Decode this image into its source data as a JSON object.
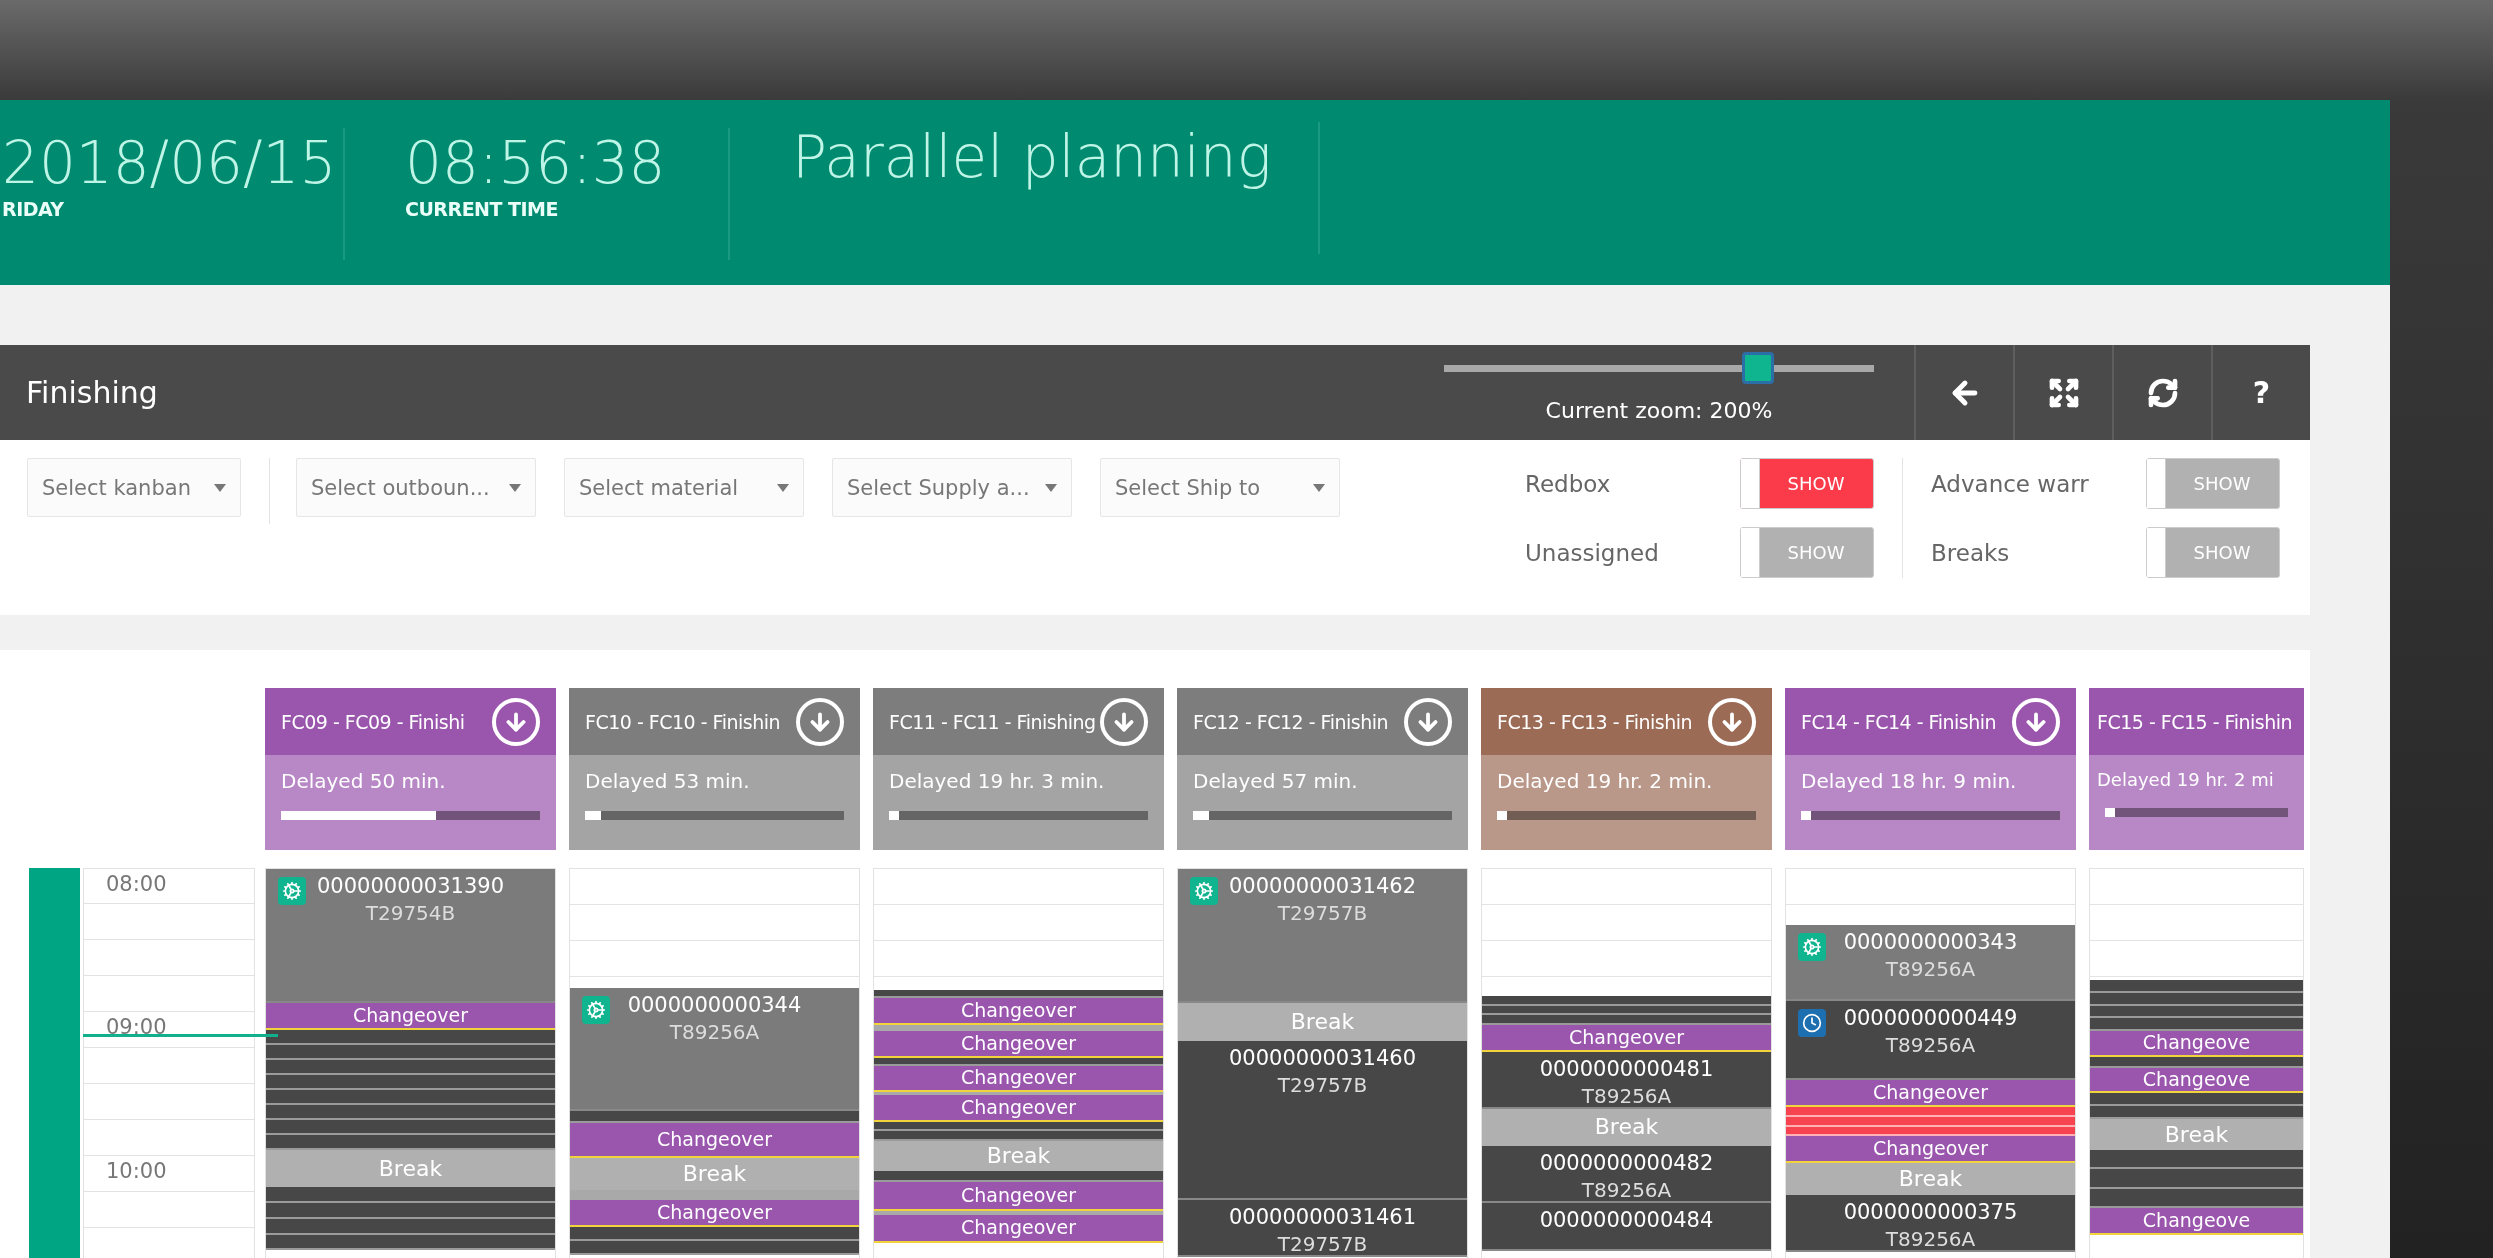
{
  "header": {
    "date": "2018/06/15",
    "weekday": "RIDAY",
    "time": "08:56:38",
    "time_label": "CURRENT TIME",
    "title": "Parallel planning"
  },
  "toolbar": {
    "title": "Finishing",
    "zoom": {
      "level": 0.73,
      "label": "Current zoom: 200%"
    },
    "help": "?"
  },
  "filters": [
    {
      "placeholder": "Select kanban"
    },
    {
      "placeholder": "Select outboun..."
    },
    {
      "placeholder": "Select material"
    },
    {
      "placeholder": "Select Supply a..."
    },
    {
      "placeholder": "Select Ship to"
    }
  ],
  "toggle_groups": [
    [
      {
        "label": "Redbox",
        "text": "SHOW",
        "on": true
      },
      {
        "label": "Unassigned",
        "text": "SHOW",
        "on": false
      }
    ],
    [
      {
        "label": "Advance warr",
        "text": "SHOW",
        "on": false
      },
      {
        "label": "Breaks",
        "text": "SHOW",
        "on": false
      }
    ]
  ],
  "timeline": {
    "hours": [
      "08:00",
      "09:00",
      "10:00"
    ]
  },
  "columns": [
    {
      "title": "FC09 - FC09 - Finishi",
      "color": "#9a55ad",
      "status": "Delayed 50 min.",
      "level": 0.6,
      "blocks": [
        {
          "kind": "running-order",
          "number": "00000000031390",
          "material": "T29754B"
        },
        {
          "kind": "changeover",
          "text": "Changeover"
        },
        {
          "kind": "sliver"
        },
        {
          "kind": "sliver"
        },
        {
          "kind": "sliver"
        },
        {
          "kind": "sliver"
        },
        {
          "kind": "sliver"
        },
        {
          "kind": "sliver"
        },
        {
          "kind": "sliver"
        },
        {
          "kind": "sliver"
        },
        {
          "kind": "break",
          "text": "Break"
        },
        {
          "kind": "sliver"
        },
        {
          "kind": "sliver"
        },
        {
          "kind": "sliver"
        },
        {
          "kind": "sliver"
        }
      ]
    },
    {
      "title": "FC10 - FC10 - Finishin",
      "color": "#7d7d7d",
      "status": "Delayed 53 min.",
      "level": 0.06,
      "blocks": [
        {
          "kind": "empty"
        },
        {
          "kind": "running-order",
          "number": "0000000000344",
          "material": "T89256A"
        },
        {
          "kind": "sliver"
        },
        {
          "kind": "changeover",
          "text": "Changeover"
        },
        {
          "kind": "break",
          "text": "Break"
        },
        {
          "kind": "gap"
        },
        {
          "kind": "changeover",
          "text": "Changeover"
        },
        {
          "kind": "sliver"
        },
        {
          "kind": "sliver"
        }
      ]
    },
    {
      "title": "FC11 - FC11 - Finishing",
      "color": "#7d7d7d",
      "status": "Delayed 19 hr. 3 min.",
      "level": 0.02,
      "blocks": [
        {
          "kind": "empty"
        },
        {
          "kind": "sliver"
        },
        {
          "kind": "changeover",
          "text": "Changeover"
        },
        {
          "kind": "gap"
        },
        {
          "kind": "changeover",
          "text": "Changeover"
        },
        {
          "kind": "sliver"
        },
        {
          "kind": "changeover",
          "text": "Changeover"
        },
        {
          "kind": "gap"
        },
        {
          "kind": "changeover",
          "text": "Changeover"
        },
        {
          "kind": "sliver"
        },
        {
          "kind": "sliver"
        },
        {
          "kind": "break",
          "text": "Break"
        },
        {
          "kind": "sliver"
        },
        {
          "kind": "changeover",
          "text": "Changeover"
        },
        {
          "kind": "gap"
        },
        {
          "kind": "changeover",
          "text": "Changeover"
        }
      ]
    },
    {
      "title": "FC12 - FC12 - Finishin",
      "color": "#7d7d7d",
      "status": "Delayed 57 min.",
      "level": 0.06,
      "blocks": [
        {
          "kind": "running-order",
          "number": "00000000031462",
          "material": "T29757B"
        },
        {
          "kind": "break",
          "text": "Break"
        },
        {
          "kind": "order",
          "number": "00000000031460",
          "material": "T29757B"
        },
        {
          "kind": "order",
          "number": "00000000031461",
          "material": "T29757B"
        }
      ]
    },
    {
      "title": "FC13 - FC13 - Finishin",
      "color": "#9b6b56",
      "status": "Delayed 19 hr. 2 min.",
      "level": 0.02,
      "blocks": [
        {
          "kind": "empty"
        },
        {
          "kind": "sliver"
        },
        {
          "kind": "sliver"
        },
        {
          "kind": "sliver"
        },
        {
          "kind": "changeover",
          "text": "Changeover"
        },
        {
          "kind": "order",
          "number": "0000000000481",
          "material": "T89256A"
        },
        {
          "kind": "break",
          "text": "Break"
        },
        {
          "kind": "order",
          "number": "0000000000482",
          "material": "T89256A"
        },
        {
          "kind": "order",
          "number": "0000000000484"
        }
      ]
    },
    {
      "title": "FC14 - FC14 - Finishin",
      "color": "#9a55ad",
      "status": "Delayed 18 hr. 9 min.",
      "level": 0.03,
      "blocks": [
        {
          "kind": "empty"
        },
        {
          "kind": "running-order",
          "number": "0000000000343",
          "material": "T89256A"
        },
        {
          "kind": "waiting-order",
          "number": "0000000000449",
          "material": "T89256A"
        },
        {
          "kind": "changeover",
          "text": "Changeover"
        },
        {
          "kind": "red-sliver"
        },
        {
          "kind": "red-sliver"
        },
        {
          "kind": "red-sliver"
        },
        {
          "kind": "changeover",
          "text": "Changeover"
        },
        {
          "kind": "break",
          "text": "Break"
        },
        {
          "kind": "order",
          "number": "0000000000375",
          "material": "T89256A"
        }
      ]
    },
    {
      "title": "FC15 - FC15 - Finishin",
      "color": "#9a55ad",
      "status": "Delayed 19 hr. 2 mi",
      "level": 0.03,
      "blocks": [
        {
          "kind": "empty"
        },
        {
          "kind": "sliver"
        },
        {
          "kind": "sliver"
        },
        {
          "kind": "sliver"
        },
        {
          "kind": "sliver"
        },
        {
          "kind": "changeover",
          "text": "Changeove"
        },
        {
          "kind": "sliver"
        },
        {
          "kind": "changeover",
          "text": "Changeove"
        },
        {
          "kind": "sliver"
        },
        {
          "kind": "sliver"
        },
        {
          "kind": "break",
          "text": "Break"
        },
        {
          "kind": "sliver"
        },
        {
          "kind": "sliver"
        },
        {
          "kind": "sliver"
        },
        {
          "kind": "changeover",
          "text": "Changeove"
        }
      ]
    }
  ]
}
